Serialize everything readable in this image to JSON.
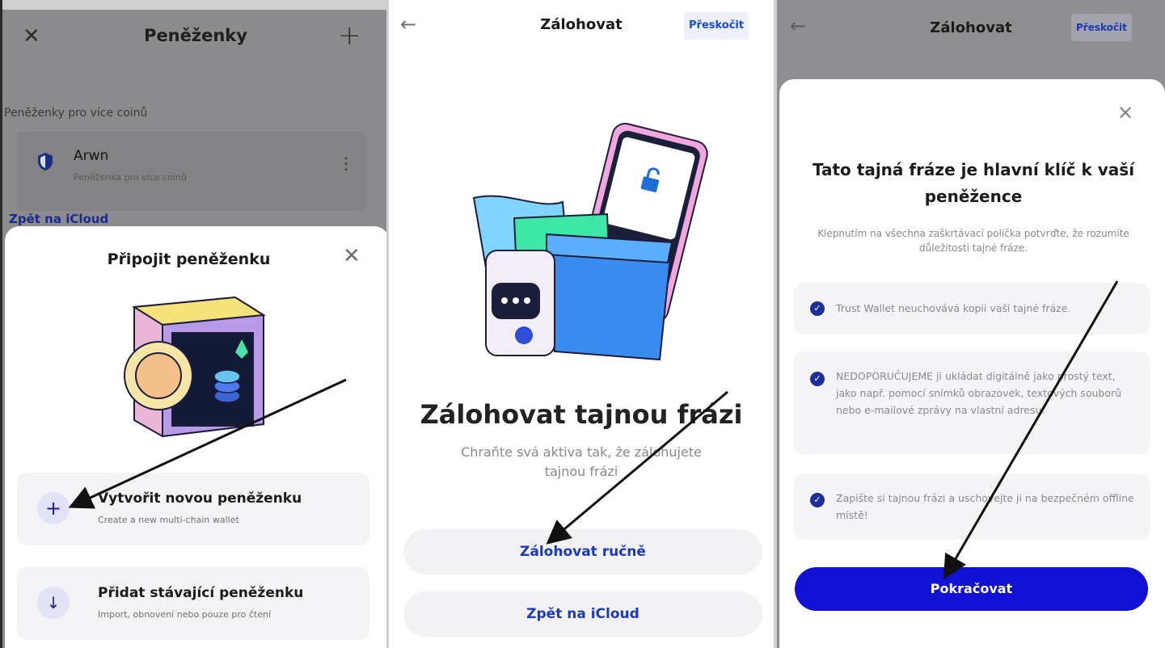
{
  "wallets_screen": {
    "close_icon": "close-icon",
    "title": "Peněženky",
    "add_icon": "plus-icon",
    "section_label": "Peněženky pro více coinů",
    "wallet": {
      "name": "Arwn",
      "type": "Peněženka pro více coinů"
    },
    "icloud_link": "Zpět na iCloud",
    "sheet": {
      "title": "Připojit peněženku",
      "options": [
        {
          "icon": "plus-icon",
          "title": "Vytvořit novou peněženku",
          "subtitle": "Create a new multi-chain wallet"
        },
        {
          "icon": "arrow-down-icon",
          "title": "Přidat stávající peněženku",
          "subtitle": "Import, obnovení nebo pouze pro čtení"
        }
      ]
    }
  },
  "backup_screen": {
    "title": "Zálohovat",
    "skip_label": "Přeskočit",
    "heading": "Zálohovat tajnou frázi",
    "description": "Chraňte svá aktiva tak, že zálohujete tajnou frázi",
    "manual_button": "Zálohovat ručně",
    "icloud_button": "Zpět na iCloud"
  },
  "confirm_screen": {
    "title": "Zálohovat",
    "skip_label": "Přeskočit",
    "heading": "Tato tajná fráze je hlavní klíč k vaší peněžence",
    "description": "Klepnutím na všechna zaškrtávací políčka potvrďte, že rozumíte důležitosti tajné fráze.",
    "checks": [
      "Trust Wallet neuchovává kopii vaší tajné fráze.",
      "NEDOPORUČUJEME ji ukládat digitálně jako prostý text, jako např. pomocí snímků obrazovek, textových souborů nebo e-mailové zprávy na vlastní adresu.",
      "Zapište si tajnou frázi a uschovejte ji na bezpečném offline místě!"
    ],
    "continue_button": "Pokračovat"
  },
  "colors": {
    "accent": "#1111d4",
    "link": "#1c3ab8",
    "check": "#1c2f9a"
  }
}
